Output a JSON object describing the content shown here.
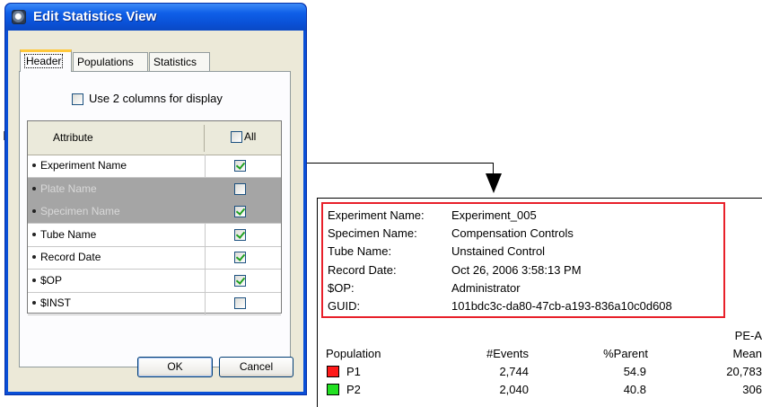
{
  "dialog": {
    "title": "Edit Statistics View",
    "tabs": [
      {
        "label": "Header",
        "active": true
      },
      {
        "label": "Populations",
        "active": false
      },
      {
        "label": "Statistics",
        "active": false
      }
    ],
    "use_two_columns": {
      "label": "Use 2 columns for display",
      "checked": false
    },
    "grid": {
      "col_attribute": "Attribute",
      "col_all": "All",
      "all_checked": false,
      "rows": [
        {
          "label": "Experiment Name",
          "checked": true,
          "disabled": false
        },
        {
          "label": "Plate Name",
          "checked": false,
          "disabled": true
        },
        {
          "label": "Specimen Name",
          "checked": true,
          "disabled": true
        },
        {
          "label": "Tube Name",
          "checked": true,
          "disabled": false
        },
        {
          "label": "Record Date",
          "checked": true,
          "disabled": false
        },
        {
          "label": "$OP",
          "checked": true,
          "disabled": false
        },
        {
          "label": "$INST",
          "checked": false,
          "disabled": false
        }
      ]
    },
    "ok_label": "OK",
    "cancel_label": "Cancel"
  },
  "report": {
    "header_fields": [
      {
        "key": "Experiment Name:",
        "value": "Experiment_005"
      },
      {
        "key": "Specimen Name:",
        "value": "Compensation Controls"
      },
      {
        "key": "Tube Name:",
        "value": "Unstained Control"
      },
      {
        "key": "Record Date:",
        "value": "Oct 26, 2006 3:58:13 PM"
      },
      {
        "key": "$OP:",
        "value": "Administrator"
      },
      {
        "key": "GUID:",
        "value": "101bdc3c-da80-47cb-a193-836a10c0d608"
      }
    ],
    "table": {
      "col_population": "Population",
      "col_events": "#Events",
      "col_parent": "%Parent",
      "col_pe_a": "PE-A",
      "col_mean": "Mean",
      "rows": [
        {
          "name": "P1",
          "color": "#ff1a1a",
          "events": "2,744",
          "parent": "54.9",
          "mean": "20,783"
        },
        {
          "name": "P2",
          "color": "#22e022",
          "events": "2,040",
          "parent": "40.8",
          "mean": "306"
        }
      ]
    },
    "highlight_color": "#e8202a"
  }
}
